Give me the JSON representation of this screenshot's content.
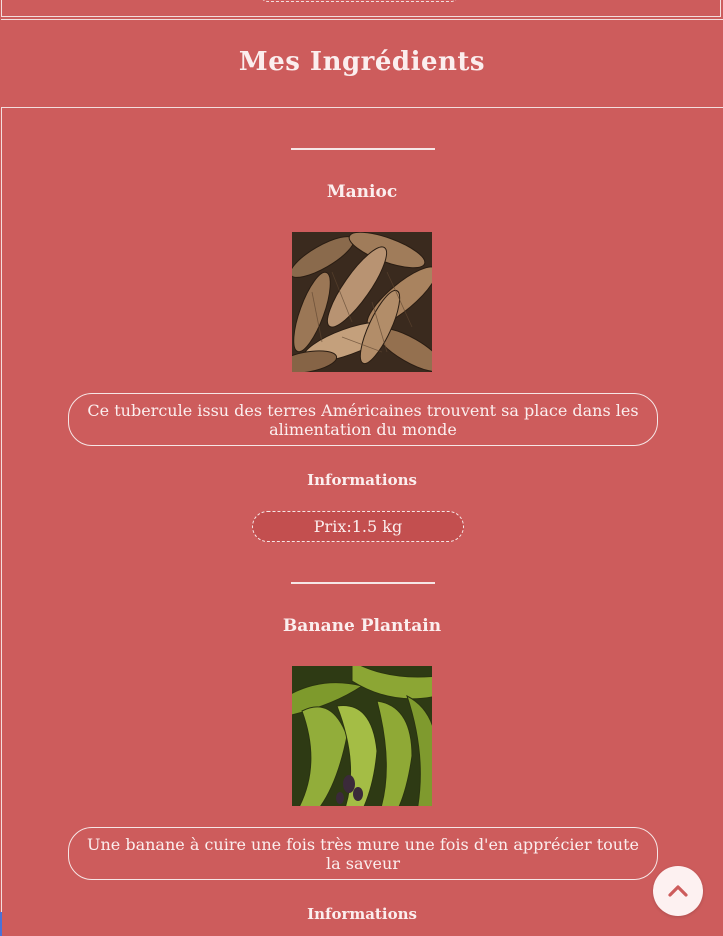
{
  "page": {
    "title": "Mes Ingrédients"
  },
  "ingredients": [
    {
      "name": "Manioc",
      "image_icon": "cassava-photo",
      "description": "Ce tubercule issu des terres Américaines trouvent sa place dans les alimentation du monde",
      "info_heading": "Informations",
      "price": "Prix:1.5 kg"
    },
    {
      "name": "Banane Plantain",
      "image_icon": "plantain-photo",
      "description": "Une banane à cuire une fois très mure une fois d'en apprécier toute la saveur",
      "info_heading": "Informations"
    }
  ],
  "scroll_top": {
    "icon": "chevron-up-icon"
  },
  "colors": {
    "background": "#cd5c5c",
    "text": "#fbeeee",
    "border": "#f3dede",
    "button": "#fdf1f1"
  }
}
